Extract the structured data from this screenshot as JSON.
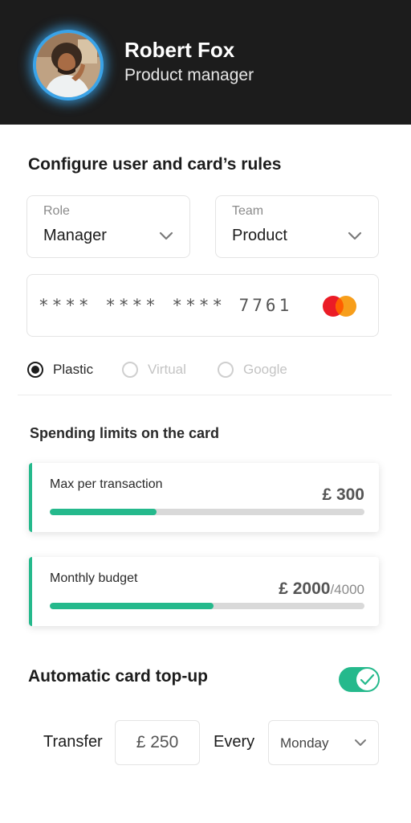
{
  "user": {
    "name": "Robert Fox",
    "role": "Product manager"
  },
  "config": {
    "title": "Configure user and card’s rules",
    "role_select": {
      "label": "Role",
      "value": "Manager"
    },
    "team_select": {
      "label": "Team",
      "value": "Product"
    },
    "card_number": "**** **** **** 7761",
    "card_brand_icon": "mastercard-logo",
    "card_types": [
      {
        "label": "Plastic",
        "selected": true
      },
      {
        "label": "Virtual",
        "selected": false
      },
      {
        "label": "Google",
        "selected": false
      }
    ]
  },
  "limits": {
    "title": "Spending limits on the card",
    "max_per_transaction": {
      "label": "Max per transaction",
      "amount": "£ 300",
      "progress": 0.34
    },
    "monthly_budget": {
      "label": "Monthly budget",
      "amount": "£ 2000",
      "total": "/4000",
      "progress": 0.52
    }
  },
  "topup": {
    "title": "Automatic card top-up",
    "enabled": true,
    "transfer_label": "Transfer",
    "transfer_amount": "£ 250",
    "every_label": "Every",
    "day": "Monday"
  },
  "colors": {
    "accent": "#25b98c",
    "header_bg": "#1c1c1c",
    "avatar_ring": "#3aa3e8"
  }
}
